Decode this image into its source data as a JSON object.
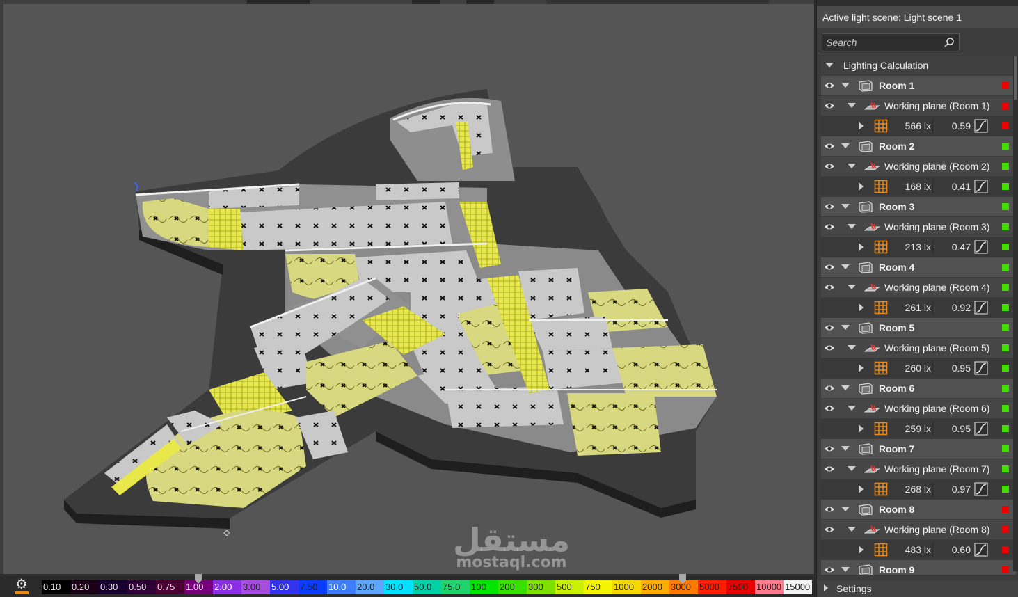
{
  "panel": {
    "active_scene": "Active light scene: Light scene 1",
    "search_placeholder": "Search",
    "group_title": "Lighting Calculation",
    "settings_label": "Settings",
    "rooms": [
      {
        "name": "Room 1",
        "plane": "Working plane (Room 1)",
        "lux": "566 lx",
        "uniformity": "0.59",
        "status": "red"
      },
      {
        "name": "Room 2",
        "plane": "Working plane (Room 2)",
        "lux": "168 lx",
        "uniformity": "0.41",
        "status": "green"
      },
      {
        "name": "Room 3",
        "plane": "Working plane (Room 3)",
        "lux": "213 lx",
        "uniformity": "0.47",
        "status": "green"
      },
      {
        "name": "Room 4",
        "plane": "Working plane (Room 4)",
        "lux": "261 lx",
        "uniformity": "0.92",
        "status": "green"
      },
      {
        "name": "Room 5",
        "plane": "Working plane (Room 5)",
        "lux": "260 lx",
        "uniformity": "0.95",
        "status": "green"
      },
      {
        "name": "Room 6",
        "plane": "Working plane (Room 6)",
        "lux": "259 lx",
        "uniformity": "0.95",
        "status": "green"
      },
      {
        "name": "Room 7",
        "plane": "Working plane (Room 7)",
        "lux": "268 lx",
        "uniformity": "0.97",
        "status": "green"
      },
      {
        "name": "Room 8",
        "plane": "Working plane (Room 8)",
        "lux": "483 lx",
        "uniformity": "0.60",
        "status": "red"
      },
      {
        "name": "Room 9",
        "status": "red"
      }
    ]
  },
  "scale": {
    "values": [
      "0.10",
      "0.20",
      "0.30",
      "0.50",
      "0.75",
      "1.00",
      "2.00",
      "3.00",
      "5.00",
      "7.50",
      "10.0",
      "20.0",
      "30.0",
      "50.0",
      "75.0",
      "100",
      "200",
      "300",
      "500",
      "750",
      "1000",
      "2000",
      "3000",
      "5000",
      "7500",
      "10000",
      "15000"
    ],
    "colors": [
      "#000000",
      "#1c0016",
      "#17002e",
      "#2e0036",
      "#4b0033",
      "#77007a",
      "#8a2ee6",
      "#a64de0",
      "#3333ee",
      "#0a3cff",
      "#3f7dff",
      "#5ca6ff",
      "#00e0ff",
      "#00d2a8",
      "#1fd46b",
      "#00e600",
      "#38e000",
      "#7ee000",
      "#c8f000",
      "#f4f400",
      "#f5d800",
      "#ffab00",
      "#ff7a00",
      "#ff1a00",
      "#e60000",
      "#ff7a8a",
      "#f2f2f2"
    ],
    "text_colors": [
      "#e0e0e0",
      "#e0e0e0",
      "#e0e0e0",
      "#e0e0e0",
      "#e0e0e0",
      "#e0e0e0",
      "#ffffff",
      "#222222",
      "#ffffff",
      "#222222",
      "#ffffff",
      "#222222",
      "#222222",
      "#222222",
      "#222222",
      "#222222",
      "#222222",
      "#222222",
      "#222222",
      "#222222",
      "#222222",
      "#222222",
      "#222222",
      "#222222",
      "#222222",
      "#222222",
      "#222222"
    ],
    "slider_low": "1.00",
    "slider_high": "3000"
  },
  "status_colors": {
    "red": "#ee0000",
    "green": "#44dd00"
  },
  "watermark": {
    "arabic": "مستقل",
    "latin": "mostaql.com"
  }
}
